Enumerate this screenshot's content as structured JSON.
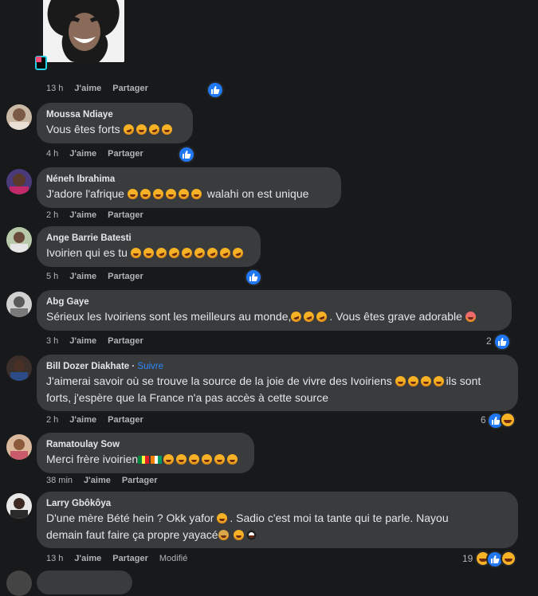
{
  "actions": {
    "like": "J'aime",
    "share": "Partager"
  },
  "top_post": {
    "time": "13 h"
  },
  "comments": [
    {
      "name": "Moussa Ndiaye",
      "text": "Vous êtes forts",
      "time": "4 h"
    },
    {
      "name": "Néneh Ibrahima",
      "text_a": "J'adore l'afrique",
      "text_b": "walahi on est unique",
      "time": "2 h"
    },
    {
      "name": "Ange Barrie Batesti",
      "text": "Ivoirien qui es tu",
      "time": "5 h"
    },
    {
      "name": "Abg Gaye",
      "text_a": "Sérieux les Ivoiriens sont les meilleurs au monde,",
      "text_b": ". Vous êtes grave adorable",
      "time": "3 h",
      "reactions": "2"
    },
    {
      "name": "Bill Dozer Diakhate",
      "follow": "Suivre",
      "line1": "J'aimerai savoir où se trouve la source de la joie de vivre des Ivoiriens",
      "line1b": "ils sont",
      "line2": "forts, j'espère que la France n'a pas accès à cette source",
      "time": "2 h",
      "reactions": "6"
    },
    {
      "name": "Ramatoulay Sow",
      "text": "Merci frère ivoirien",
      "time": "38 min"
    },
    {
      "name": "Larry Gbôkôya",
      "line1a": "D'une mère Bété hein ? Okk yafor",
      "line1b": ". Sadio c'est moi ta tante qui te parle. Nayou",
      "line2": "demain faut faire ça propre yayacé",
      "time": "13 h",
      "modified": "Modifié",
      "reactions": "19"
    }
  ],
  "colors": {
    "background": "#18191a",
    "bubble": "#3a3b3c",
    "like_blue": "#2078f4",
    "follow_blue": "#2d88ff"
  }
}
